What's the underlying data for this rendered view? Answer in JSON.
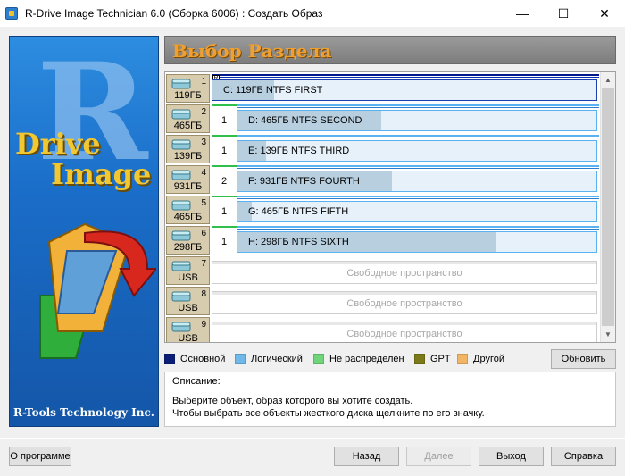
{
  "window": {
    "title": "R-Drive Image Technician 6.0 (Сборка 6006) : Создать Образ",
    "controls": {
      "minimize": "—",
      "maximize": "☐",
      "close": "✕"
    }
  },
  "banner": {
    "logo_letter": "R",
    "logo_line1": "Drive",
    "logo_line2": "Image",
    "company": "R-Tools Technology Inc."
  },
  "heading": {
    "title": "Выбор Раздела"
  },
  "disks": [
    {
      "num": "1",
      "size": "119ГБ",
      "partition": {
        "type": "primary",
        "num": "",
        "marker": "R",
        "label": "C:  119ГБ  NTFS  FIRST",
        "fill": 0.16
      }
    },
    {
      "num": "2",
      "size": "465ГБ",
      "partition": {
        "type": "logical",
        "num": "1",
        "label": "D:  465ГБ  NTFS  SECOND",
        "fill": 0.4
      }
    },
    {
      "num": "3",
      "size": "139ГБ",
      "partition": {
        "type": "logical",
        "num": "1",
        "label": "E:  139ГБ  NTFS  THIRD",
        "fill": 0.08
      }
    },
    {
      "num": "4",
      "size": "931ГБ",
      "partition": {
        "type": "logical",
        "num": "2",
        "label": "F:  931ГБ  NTFS  FOURTH",
        "fill": 0.43
      }
    },
    {
      "num": "5",
      "size": "465ГБ",
      "partition": {
        "type": "logical",
        "num": "1",
        "label": "G:  465ГБ  NTFS  FIFTH",
        "fill": 0.04
      }
    },
    {
      "num": "6",
      "size": "298ГБ",
      "partition": {
        "type": "logical",
        "num": "1",
        "label": "H:  298ГБ  NTFS  SIXTH",
        "fill": 0.72
      }
    },
    {
      "num": "7",
      "size": "USB",
      "free_label": "Свободное пространство"
    },
    {
      "num": "8",
      "size": "USB",
      "free_label": "Свободное пространство"
    },
    {
      "num": "9",
      "size": "USB",
      "free_label": "Свободное пространство"
    }
  ],
  "legend": [
    {
      "label": "Основной",
      "color": "#0b1f78"
    },
    {
      "label": "Логический",
      "color": "#6fb8e8"
    },
    {
      "label": "Не распределен",
      "color": "#6fd47a"
    },
    {
      "label": "GPT",
      "color": "#7a7a18"
    },
    {
      "label": "Другой",
      "color": "#f2b566"
    }
  ],
  "buttons": {
    "refresh": "Обновить",
    "about": "О программе",
    "back": "Назад",
    "next": "Далее",
    "exit": "Выход",
    "help": "Справка"
  },
  "description": {
    "title": "Описание:",
    "line1": "Выберите объект, образ которого вы хотите создать.",
    "line2": "Чтобы выбрать все объекты жесткого диска щелкните по его значку."
  }
}
